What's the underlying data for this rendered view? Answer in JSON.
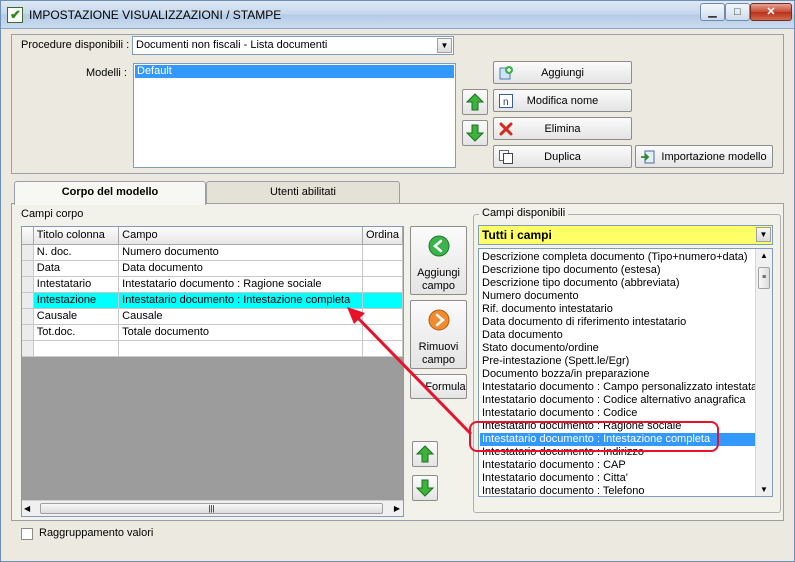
{
  "window": {
    "title": "IMPOSTAZIONE VISUALIZZAZIONI / STAMPE",
    "buttons": {
      "minimize": "▁",
      "maximize": "□",
      "close": "✕"
    }
  },
  "top": {
    "procedure_label": "Procedure disponibili :",
    "procedure_value": "Documenti non fiscali - Lista documenti",
    "modelli_label": "Modelli :",
    "modelli": [
      "Default"
    ],
    "buttons": {
      "aggiungi": "Aggiungi",
      "modifica_nome": "Modifica nome",
      "elimina": "Elimina",
      "duplica": "Duplica",
      "importazione": "Importazione modello"
    }
  },
  "tabs": [
    {
      "label": "Corpo del modello",
      "active": true
    },
    {
      "label": "Utenti abilitati",
      "active": false
    }
  ],
  "campi_corpo": {
    "label": "Campi corpo",
    "columns": [
      "Titolo colonna",
      "Campo",
      "Ordina"
    ],
    "rows": [
      {
        "titolo": "N. doc.",
        "campo": "Numero documento"
      },
      {
        "titolo": "Data",
        "campo": "Data documento"
      },
      {
        "titolo": "Intestatario",
        "campo": "Intestatario documento : Ragione sociale"
      },
      {
        "titolo": "Intestazione",
        "campo": "Intestatario documento : Intestazione completa",
        "selected": true
      },
      {
        "titolo": "Causale",
        "campo": "Causale"
      },
      {
        "titolo": "Tot.doc.",
        "campo": "Totale documento"
      },
      {
        "titolo": "",
        "campo": ""
      }
    ]
  },
  "middle_buttons": {
    "aggiungi_campo": [
      "Aggiungi",
      "campo"
    ],
    "rimuovi_campo": [
      "Rimuovi",
      "campo"
    ],
    "formula": "Formula"
  },
  "campi_disponibili": {
    "label": "Campi disponibili",
    "filter": "Tutti i campi",
    "items": [
      "Descrizione completa documento (Tipo+numero+data)",
      "Descrizione tipo documento (estesa)",
      "Descrizione tipo documento (abbreviata)",
      "Numero documento",
      "Rif. documento intestatario",
      "Data documento di riferimento intestatario",
      "Data documento",
      "Stato documento/ordine",
      "Pre-intestazione (Spett.le/Egr)",
      "Documento bozza/in preparazione",
      "Intestatario documento : Campo personalizzato intestatario",
      "Intestatario documento : Codice alternativo anagrafica",
      "Intestatario documento : Codice",
      "Intestatario documento : Ragione sociale",
      "Intestatario documento : Intestazione completa",
      "Intestatario documento : Indirizzo",
      "Intestatario documento : CAP",
      "Intestatario documento : Citta'",
      "Intestatario documento : Telefono"
    ],
    "selected_index": 14
  },
  "footer": {
    "raggruppamento_label": "Raggruppamento valori"
  },
  "colors": {
    "selected_row": "#00ffff",
    "list_selection": "#3399ff",
    "annotation": "#e8132a",
    "filter_bg": "#ffff66"
  }
}
